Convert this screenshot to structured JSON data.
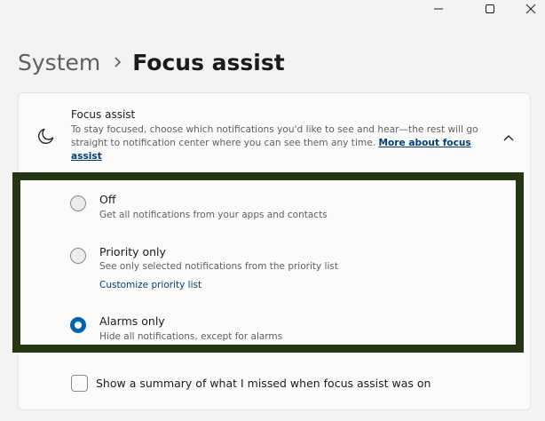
{
  "window_controls": {
    "minimize_icon": "minimize-icon",
    "maximize_icon": "maximize-icon",
    "close_icon": "close-icon"
  },
  "breadcrumb": {
    "parent": "System",
    "separator_icon": "chevron-right-icon",
    "current": "Focus assist"
  },
  "focus_card": {
    "icon": "moon-icon",
    "title": "Focus assist",
    "description": "To stay focused, choose which notifications you'd like to see and hear—the rest will go straight to notification center where you can see them any time.",
    "link": "More about focus assist",
    "collapse_icon": "chevron-up-icon"
  },
  "options": {
    "selected": "alarms",
    "items": [
      {
        "id": "off",
        "label": "Off",
        "description": "Get all notifications from your apps and contacts"
      },
      {
        "id": "priority",
        "label": "Priority only",
        "description": "See only selected notifications from the priority list",
        "link": "Customize priority list"
      },
      {
        "id": "alarms",
        "label": "Alarms only",
        "description": "Hide all notifications, except for alarms"
      }
    ]
  },
  "summary_checkbox": {
    "label": "Show a summary of what I missed when focus assist was on",
    "checked": false
  },
  "colors": {
    "accent": "#0063b1",
    "link": "#003e73",
    "highlight_border": "#253612",
    "background": "#f3f3f3",
    "card": "#fbfbfb"
  }
}
